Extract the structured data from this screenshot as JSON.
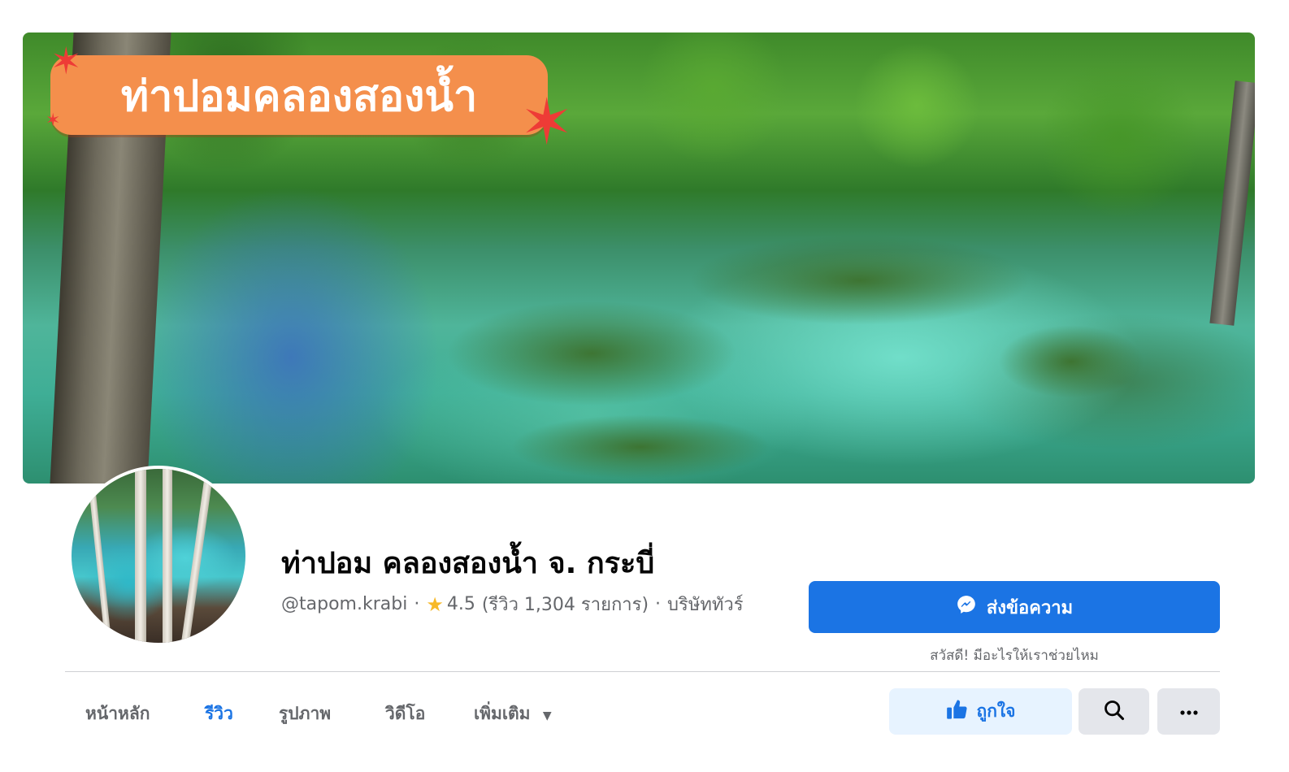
{
  "cover": {
    "title": "ท่าปอมคลองสองน้ำ",
    "badge_color": "#f48f4c",
    "star_color": "#ee3b36"
  },
  "profile": {
    "name": "ท่าปอม คลองสองน้ำ จ. กระบี่",
    "username": "@tapom.krabi",
    "separator": "·",
    "rating": "4.5",
    "reviews": "(รีวิว 1,304 รายการ)",
    "category": "บริษัททัวร์"
  },
  "actions": {
    "send_message": "ส่งข้อความ",
    "greeting": "สวัสดี! มีอะไรให้เราช่วยไหม",
    "like": "ถูกใจ",
    "search_icon": "search-icon",
    "more_icon": "more-icon"
  },
  "tabs": [
    {
      "label": "หน้าหลัก",
      "active": false
    },
    {
      "label": "รีวิว",
      "active": true
    },
    {
      "label": "รูปภาพ",
      "active": false
    },
    {
      "label": "วิดีโอ",
      "active": false
    },
    {
      "label": "เพิ่มเติม",
      "active": false
    }
  ],
  "colors": {
    "accent": "#1b74e4",
    "like_bg": "#e7f3ff",
    "muted": "#65676b",
    "rating_star": "#f7b928"
  }
}
